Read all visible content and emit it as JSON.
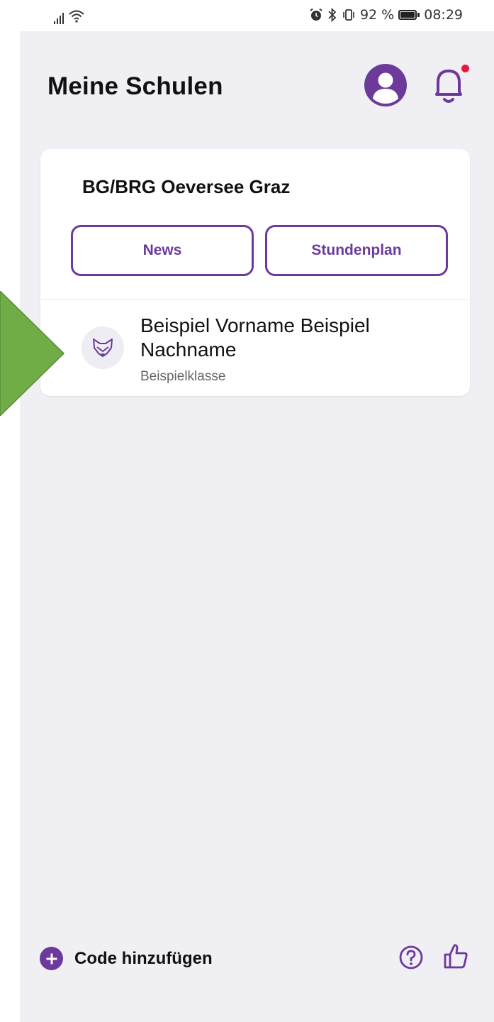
{
  "status_bar": {
    "battery_percent": "92 %",
    "time": "08:29",
    "icons": [
      "signal-icon",
      "wifi-icon",
      "alarm-icon",
      "bluetooth-icon",
      "vibrate-icon",
      "battery-icon"
    ]
  },
  "header": {
    "title": "Meine Schulen",
    "profile_icon": "profile-icon",
    "notification_icon": "bell-icon",
    "has_unread_notification": true
  },
  "school_card": {
    "name": "BG/BRG Oeversee Graz",
    "buttons": {
      "news_label": "News",
      "timetable_label": "Stundenplan"
    },
    "student": {
      "icon": "fox-icon",
      "name": "Beispiel Vorname Beispiel Nachname",
      "class": "Beispielklasse"
    }
  },
  "footer": {
    "add_code_label": "Code hinzufügen",
    "help_icon": "help-icon",
    "feedback_icon": "thumbs-up-icon"
  },
  "colors": {
    "accent": "#6b3a9b",
    "background": "#f0eff4",
    "notification_dot": "#e8183f",
    "overlay_arrow": "#70ad47"
  }
}
